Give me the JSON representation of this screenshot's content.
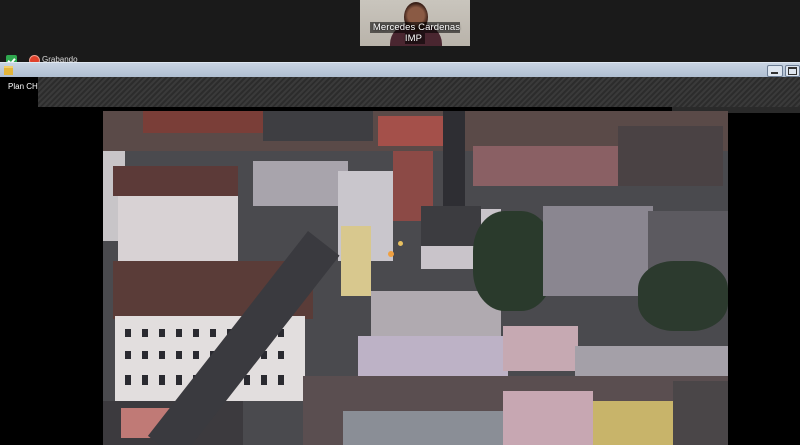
{
  "participant": {
    "name": "Mercedes Cardenas IMP"
  },
  "status": {
    "recording_label": "Grabando"
  },
  "window": {
    "tab_label": "Plan CHC"
  },
  "colors": {
    "recording": "#e0412b",
    "secure": "#2fa84f",
    "background": "#000000"
  },
  "icons": [
    "shield-check-icon",
    "record-icon",
    "folder-icon",
    "minimize-icon",
    "maximize-icon"
  ]
}
